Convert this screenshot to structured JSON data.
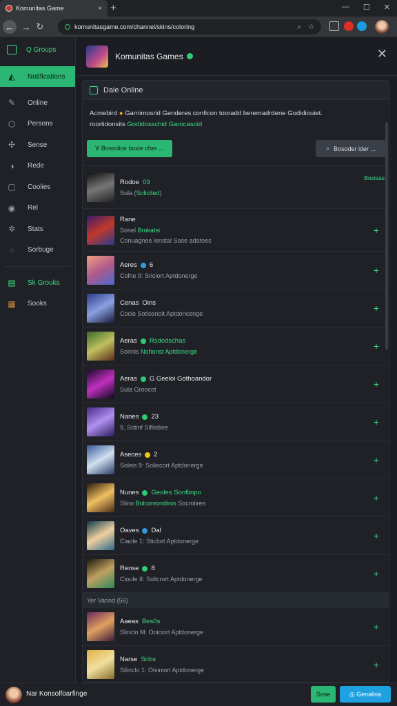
{
  "browser": {
    "tab_title": "Komunitas Game",
    "url": "komunitasgame.com/channel/skins/coloring",
    "new_tab_glyph": "+",
    "tab_close_glyph": "×"
  },
  "sidebar": {
    "top_label": "Q Groups",
    "items": [
      {
        "label": "Notifications",
        "icon": "signal-icon",
        "glyph": "◭"
      },
      {
        "label": "Online",
        "icon": "pin-icon",
        "glyph": "✎"
      },
      {
        "label": "Persons",
        "icon": "shield-icon",
        "glyph": "⬡"
      },
      {
        "label": "Sense",
        "icon": "gamepad-icon",
        "glyph": "✣"
      },
      {
        "label": "Rede",
        "icon": "globe-icon",
        "glyph": "◑"
      },
      {
        "label": "Coolies",
        "icon": "square-icon",
        "glyph": "▢"
      },
      {
        "label": "Rel",
        "icon": "disc-icon",
        "glyph": "◉"
      },
      {
        "label": "Stats",
        "icon": "gear-icon",
        "glyph": "✲"
      },
      {
        "label": "Sorbuge",
        "icon": "refresh-icon",
        "glyph": "◌"
      }
    ],
    "green_item": {
      "label": "Sk Grouks",
      "icon": "book-icon",
      "glyph": "▤"
    },
    "last_item": {
      "label": "Sooks",
      "icon": "chest-icon",
      "glyph": "▦"
    }
  },
  "header": {
    "title": "Komunitas Games",
    "close_glyph": "✕"
  },
  "panel": {
    "title": "Daie Online",
    "note_line1_a": "Acmebird",
    "note_line1_b": "Garnimosrid Genderes conficon tooradd beremadrdene Godidiouiet.",
    "note_line2_a": "roortidonsits",
    "note_line2_b": "Godidosschid Garocasoid",
    "btn_primary": "∀ Bosodice boxie cher ...",
    "btn_search": "Bosoder ider ...",
    "section_label": "Yer Varind (56)"
  },
  "rows": [
    {
      "name": "Rodoe",
      "badge": "03",
      "sub_a": "Sula (",
      "sub_b": "Solicited",
      "sub_c": ")",
      "line3": "",
      "right": "Bosisas",
      "dot": ""
    },
    {
      "name": "Rane",
      "badge": "",
      "sub_a": "Sonel ",
      "sub_b": "Brokatsi",
      "sub_c": "",
      "line3": "Conuagnee lenstal Sase adatoes",
      "right": "",
      "dot": ""
    },
    {
      "name": "Aeres",
      "badge": "6",
      "sub_a": "Colhe 9: Sriclort Aptdonerge",
      "sub_b": "",
      "sub_c": "",
      "line3": "",
      "right": "",
      "dot": "blue"
    },
    {
      "name": "Cenas",
      "badge": "Oins",
      "sub_a": "Cocle Sotlosnoit Aptdoncenge",
      "sub_b": "",
      "sub_c": "",
      "line3": "",
      "right": "",
      "dot": ""
    },
    {
      "name": "Aeras",
      "badge": "Rsdodschas",
      "sub_a": "Sorinis ",
      "sub_b": "Nohonst Aptdonerge",
      "sub_c": "",
      "line3": "",
      "right": "",
      "dot": "green"
    },
    {
      "name": "Aeras",
      "badge": "G Geeloi Gothoandor",
      "sub_a": "Sula Groocot",
      "sub_b": "",
      "sub_c": "",
      "line3": "",
      "right": "",
      "dot": "green"
    },
    {
      "name": "Nanes",
      "badge": "23",
      "sub_a": "9, Sotinf Siflodiee",
      "sub_b": "",
      "sub_c": "",
      "line3": "",
      "right": "",
      "dot": "green"
    },
    {
      "name": "Aseces",
      "badge": "2",
      "sub_a": "Soleis 9: Soliecort Aptdonerge",
      "sub_b": "",
      "sub_c": "",
      "line3": "",
      "right": "",
      "dot": "yellow"
    },
    {
      "name": "Nunes",
      "badge": "Geoles Sonfiinpo",
      "sub_a": "Slino ",
      "sub_b": "Bolconrondinis",
      "sub_c": " Socroiires",
      "line3": "",
      "right": "",
      "dot": "green"
    },
    {
      "name": "Oaves",
      "badge": "Dal",
      "sub_a": "Ciaole 1: Sticlort Aptdonerge",
      "sub_b": "",
      "sub_c": "",
      "line3": "",
      "right": "",
      "dot": "blue"
    },
    {
      "name": "Rense",
      "badge": "8",
      "sub_a": "Cioule II: Solicrort Aptdonerge",
      "sub_b": "",
      "sub_c": "",
      "line3": "",
      "right": "",
      "dot": "green"
    },
    {
      "name": "Aaeas",
      "badge": "Bes0s",
      "sub_a": "Slinclo M: Ooiciort Aptdonerge",
      "sub_b": "",
      "sub_c": "",
      "line3": "",
      "right": "",
      "dot": ""
    },
    {
      "name": "Narse",
      "badge": "Sribs",
      "sub_a": "Silinclo 1: Oisiniorl Aptdonerge",
      "sub_b": "",
      "sub_c": "",
      "line3": "",
      "right": "",
      "dot": ""
    }
  ],
  "footer": {
    "user_label": "Nar Konsolfoarfinge",
    "btn_a": "Sose",
    "btn_b": "◎ Genalina"
  },
  "colors": {
    "accent": "#2bb673",
    "link": "#3ddc84",
    "blue_button": "#1fa0e0"
  }
}
